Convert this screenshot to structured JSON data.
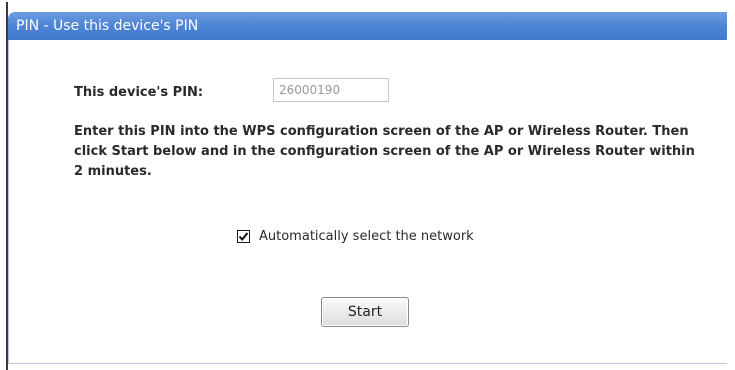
{
  "dialog": {
    "title": "PIN - Use this device's PIN",
    "title_bar_color": "#4f86d6"
  },
  "pin": {
    "label": "This device's PIN:",
    "value": "26000190"
  },
  "instructions": "Enter this PIN into the WPS configuration screen of the AP or Wireless Router. Then click Start below and in the configuration screen of the AP or Wireless Router within 2 minutes.",
  "auto_select": {
    "label": "Automatically select the network",
    "checked": true
  },
  "actions": {
    "start_label": "Start"
  }
}
